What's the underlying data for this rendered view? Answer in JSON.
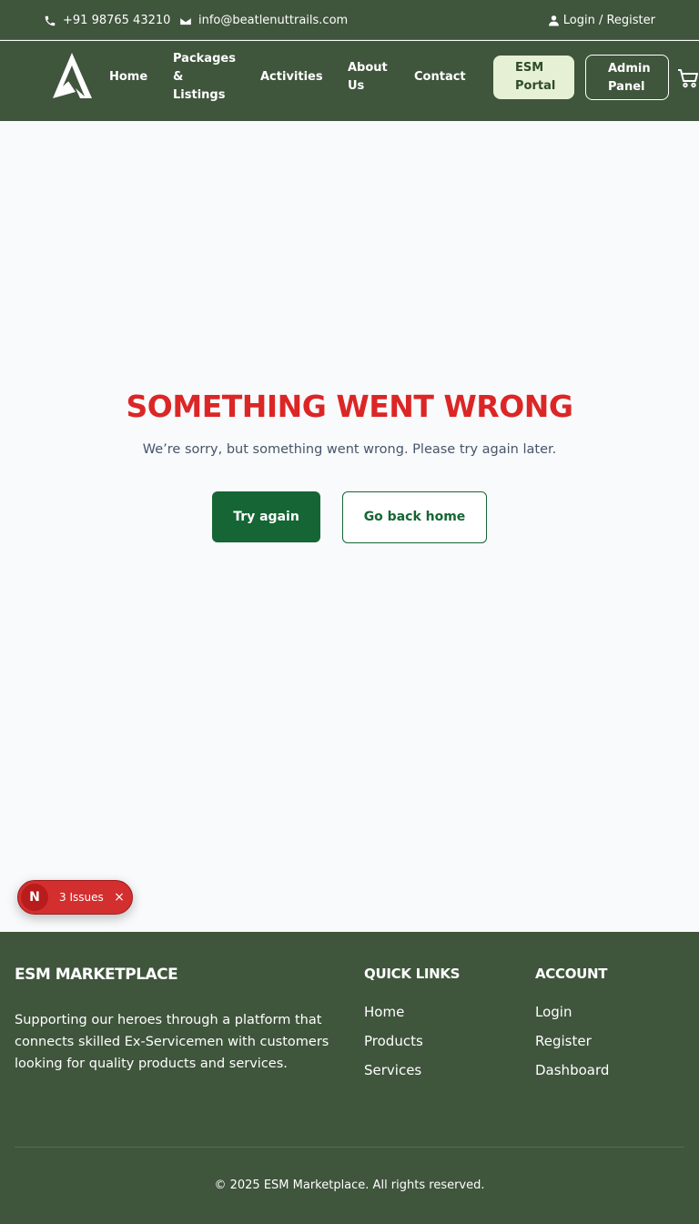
{
  "topbar": {
    "phone": "+91 98765 43210",
    "email": "info@beatlenuttrails.com",
    "login_register": "Login / Register"
  },
  "nav": {
    "items": [
      {
        "line1": "Home"
      },
      {
        "line1": "Packages",
        "line2": "&",
        "line3": "Listings"
      },
      {
        "line1": "Activities"
      },
      {
        "line1": "About",
        "line2": "Us"
      },
      {
        "line1": "Contact"
      }
    ],
    "esm_portal": {
      "line1": "ESM",
      "line2": "Portal"
    },
    "admin_panel": {
      "line1": "Admin",
      "line2": "Panel"
    }
  },
  "error": {
    "title": "SOMETHING WENT WRONG",
    "message": "We’re sorry, but something went wrong. Please try again later.",
    "try_again": "Try again",
    "go_home": "Go back home"
  },
  "issues_badge": {
    "letter": "N",
    "label": "3 Issues",
    "close": "×"
  },
  "footer": {
    "brand": "ESM MARKETPLACE",
    "description": "Supporting our heroes through a platform that connects skilled Ex-Servicemen with customers looking for quality products and services.",
    "quick_links": {
      "heading": "QUICK LINKS",
      "items": [
        "Home",
        "Products",
        "Services"
      ]
    },
    "account": {
      "heading": "ACCOUNT",
      "items": [
        "Login",
        "Register",
        "Dashboard"
      ]
    },
    "copyright": "© 2025 ESM Marketplace. All rights reserved."
  },
  "colors": {
    "header_bg": "#3f553c",
    "error_red": "#dc2626",
    "primary_green": "#166534",
    "portal_bg": "#e6f0d4"
  },
  "icons": [
    "phone-icon",
    "mail-icon",
    "user-icon",
    "logo-icon",
    "cart-icon",
    "close-icon"
  ]
}
